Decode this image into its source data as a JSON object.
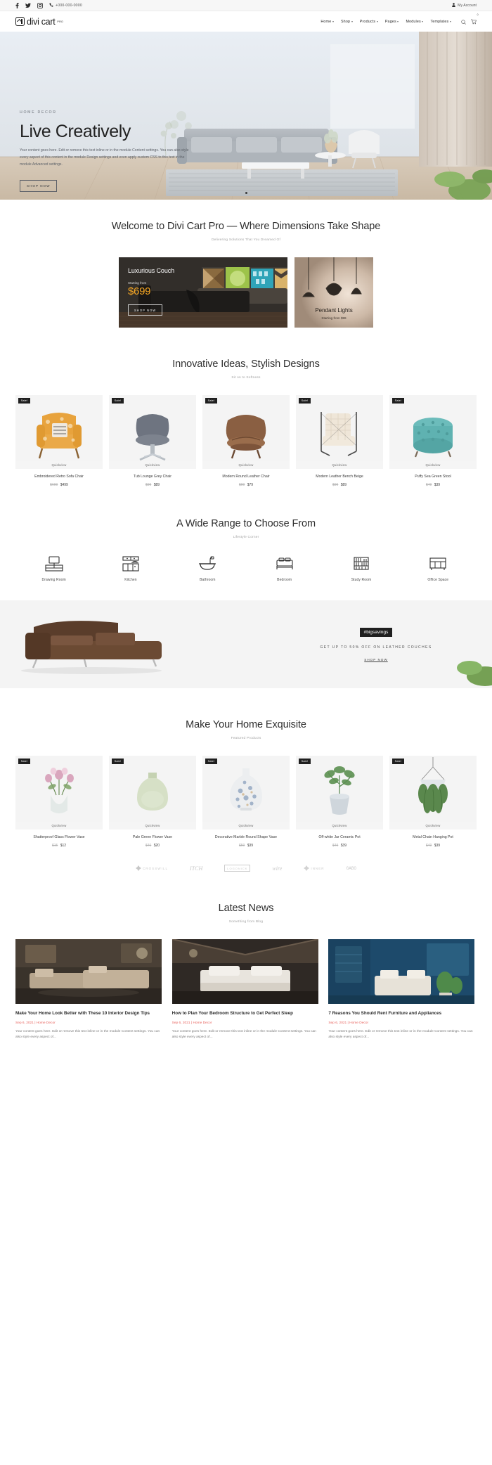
{
  "topbar": {
    "phone": "+000-000-0000",
    "account": "My Account",
    "social": [
      "facebook-icon",
      "twitter-icon",
      "instagram-icon"
    ]
  },
  "header": {
    "logo_text": "divi cart",
    "logo_sup": "PRO",
    "nav": [
      {
        "label": "Home",
        "has_dropdown": true
      },
      {
        "label": "Shop",
        "has_dropdown": true
      },
      {
        "label": "Products",
        "has_dropdown": true
      },
      {
        "label": "Pages",
        "has_dropdown": true
      },
      {
        "label": "Modules",
        "has_dropdown": true
      },
      {
        "label": "Templates",
        "has_dropdown": true
      }
    ],
    "cart_count": "0"
  },
  "hero": {
    "kicker": "HOME DECOR",
    "title": "Live Creatively",
    "description": "Your content goes here. Edit or remove this text inline or in the module Content settings. You can also style every aspect of this content in the module Design settings and even apply custom CSS to this text in the module Advanced settings.",
    "button": "SHOP NOW",
    "slides": 1
  },
  "welcome": {
    "title": "Welcome to Divi Cart Pro — Where Dimensions Take Shape",
    "subtitle": "Delivering Solutions That You Dreamed Of"
  },
  "promos": {
    "couch": {
      "title": "Luxurious Couch",
      "from_label": "Starting from",
      "price": "$699",
      "button": "SHOP NOW"
    },
    "lights": {
      "title": "Pendant Lights",
      "subtitle": "Starting from $99"
    }
  },
  "ideas": {
    "title": "Innovative Ideas, Stylish Designs",
    "subtitle": "Sit on to Softness",
    "quickview_label": "Quickview",
    "sale_label": "Sale!",
    "products": [
      {
        "name": "Embroidered Retro Sofa Chair",
        "price_old": "$699",
        "price_new": "$499",
        "sale": true,
        "image": "retro-sofa-chair"
      },
      {
        "name": "Tub Lounge Grey Chair",
        "price_old": "$99",
        "price_new": "$89",
        "sale": true,
        "image": "tub-lounge-grey-chair"
      },
      {
        "name": "Modern Round Leather Chair",
        "price_old": "$99",
        "price_new": "$79",
        "sale": true,
        "image": "round-leather-chair"
      },
      {
        "name": "Modern Leather Bench Beige",
        "price_old": "$99",
        "price_new": "$89",
        "sale": true,
        "image": "leather-bench-beige"
      },
      {
        "name": "Puffy Sea Green Stool",
        "price_old": "$49",
        "price_new": "$39",
        "sale": true,
        "image": "sea-green-stool"
      }
    ]
  },
  "categories": {
    "title": "A Wide Range to Choose From",
    "subtitle": "Lifestyle Corner",
    "items": [
      {
        "label": "Drawing Room",
        "icon": "tv-console-icon"
      },
      {
        "label": "Kitchen",
        "icon": "kitchen-cabinet-icon"
      },
      {
        "label": "Bathroom",
        "icon": "bathtub-icon"
      },
      {
        "label": "Bedroom",
        "icon": "bed-icon"
      },
      {
        "label": "Study Room",
        "icon": "bookshelf-icon"
      },
      {
        "label": "Office Space",
        "icon": "office-desk-icon"
      }
    ]
  },
  "savings": {
    "tag": "#bigsavings",
    "headline": "GET UP TO 50% OFF ON LEATHER COUCHES",
    "link": "SHOP NOW"
  },
  "featured": {
    "title": "Make Your Home Exquisite",
    "subtitle": "Featured Products",
    "quickview_label": "Quickview",
    "sale_label": "Sale!",
    "products": [
      {
        "name": "Shatterproof Glass Flower Vase",
        "price_old": "$15",
        "price_new": "$12",
        "sale": true,
        "image": "glass-flower-vase"
      },
      {
        "name": "Pale Green Flower Vase",
        "price_old": "$40",
        "price_new": "$20",
        "sale": true,
        "image": "pale-green-vase"
      },
      {
        "name": "Decorative Marble Round Shape Vase",
        "price_old": "$59",
        "price_new": "$39",
        "sale": true,
        "image": "marble-round-vase"
      },
      {
        "name": "Off-white Jar Ceramic Pot",
        "price_old": "$49",
        "price_new": "$39",
        "sale": true,
        "image": "offwhite-ceramic-pot"
      },
      {
        "name": "Metal Chain Hanging Pot",
        "price_old": "$49",
        "price_new": "$39",
        "sale": true,
        "image": "metal-chain-hanging-pot"
      }
    ]
  },
  "brands": [
    {
      "name": "CROSSWILL",
      "style": "mark"
    },
    {
      "name": "ITCH",
      "style": "script"
    },
    {
      "name": "LOGONICK",
      "style": "boxed"
    },
    {
      "name": "wire",
      "style": "handwritten"
    },
    {
      "name": "INNER",
      "style": "mark"
    },
    {
      "name": "GABO",
      "style": "block"
    }
  ],
  "news": {
    "title": "Latest News",
    "subtitle": "Something from Blog",
    "posts": [
      {
        "title": "Make Your Home Look Better with These 10 Interior Design Tips",
        "meta": "Sep 6, 2021 | Home Decor",
        "excerpt": "Your content goes here. Edit or remove this text inline or in the module Content settings. You can also style every aspect of...",
        "image": "living-room-sofa"
      },
      {
        "title": "How to Plan Your Bedroom Structure to Get Perfect Sleep",
        "meta": "Sep 6, 2021 | Home Decor",
        "excerpt": "Your content goes here. Edit or remove this text inline or in the module Content settings. You can also style every aspect of...",
        "image": "attic-bedroom"
      },
      {
        "title": "7 Reasons You Should Rent Furniture and Appliances",
        "meta": "Sep 6, 2021 | Home Decor",
        "excerpt": "Your content goes here. Edit or remove this text inline or in the module Content settings. You can also style every aspect of...",
        "image": "blue-wall-room"
      }
    ]
  },
  "colors": {
    "accent_price": "#f5a623",
    "meta_red": "#e8635e",
    "dark": "#1f1f1f",
    "bg_light": "#f4f4f4"
  }
}
